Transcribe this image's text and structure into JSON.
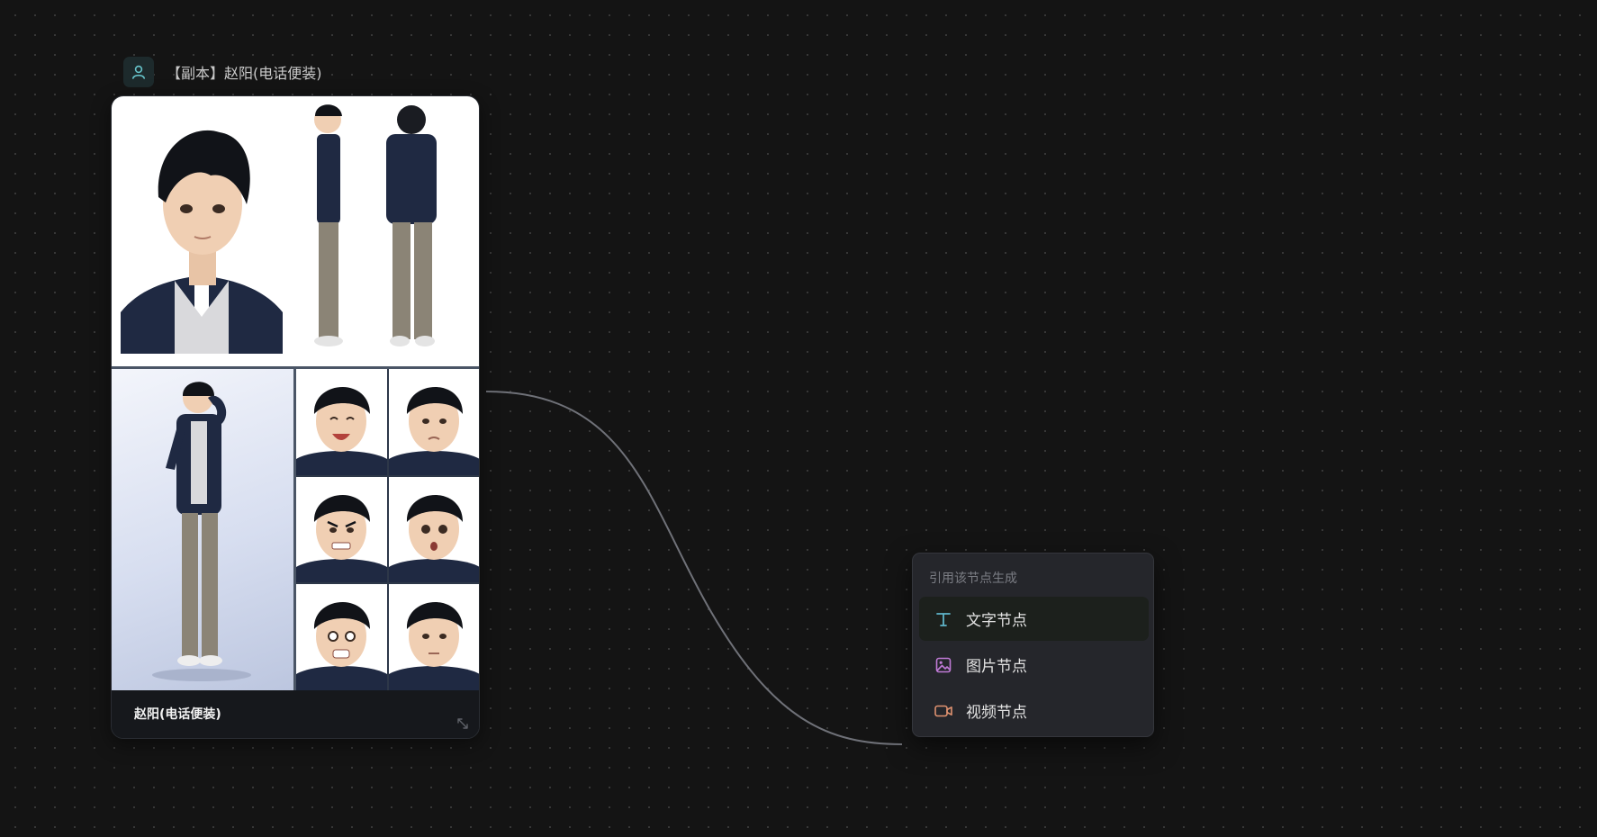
{
  "node": {
    "title": "【副本】赵阳(电话便装)",
    "type_icon": "user-icon",
    "caption": "赵阳(电话便装)",
    "image": "character-reference-sheet"
  },
  "menu": {
    "heading": "引用该节点生成",
    "items": [
      {
        "label": "文字节点",
        "icon": "text-icon",
        "color": "#5fb4c9",
        "active": true
      },
      {
        "label": "图片节点",
        "icon": "image-icon",
        "color": "#c07ad6",
        "active": false
      },
      {
        "label": "视频节点",
        "icon": "video-icon",
        "color": "#e09270",
        "active": false
      }
    ]
  },
  "colors": {
    "canvas": "#141414",
    "connector": "#6f7178",
    "menu_bg": "#25262b",
    "badge_icon": "#66c2c9"
  }
}
